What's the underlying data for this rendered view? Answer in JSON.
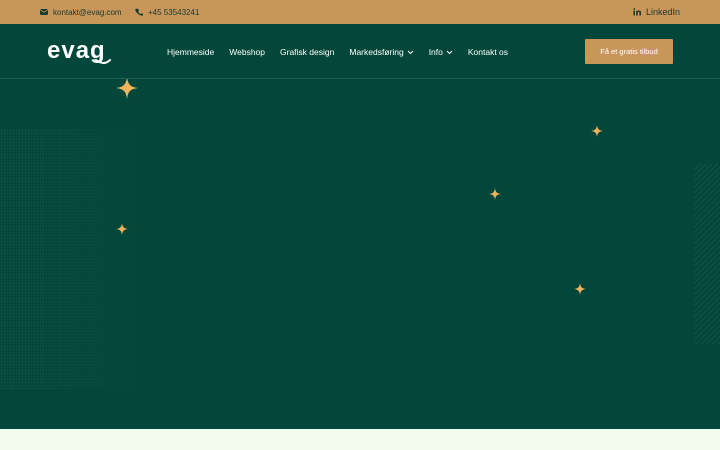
{
  "topbar": {
    "email": "kontakt@evag.com",
    "phone": "+45 53543241",
    "linkedin": "LinkedIn",
    "icons": {
      "email": "mail-icon",
      "phone": "phone-icon",
      "linkedin": "linkedin-icon"
    }
  },
  "header": {
    "logo": "evag",
    "nav": [
      {
        "label": "Hjemmeside"
      },
      {
        "label": "Webshop"
      },
      {
        "label": "Grafisk design"
      },
      {
        "label": "Markedsføring",
        "dropdown": true
      },
      {
        "label": "Info",
        "dropdown": true
      },
      {
        "label": "Kontakt os"
      }
    ],
    "cta": "Få et gratis tilbud"
  },
  "colors": {
    "topbar": "#c9965a",
    "hero": "#03473b",
    "accent": "#c9965a",
    "sparkle": "#f2b35a",
    "bottom_strip": "#f1fcef"
  },
  "decorations": {
    "sparkle_icon": "four-point-star-icon",
    "sparkle_count": 5
  }
}
